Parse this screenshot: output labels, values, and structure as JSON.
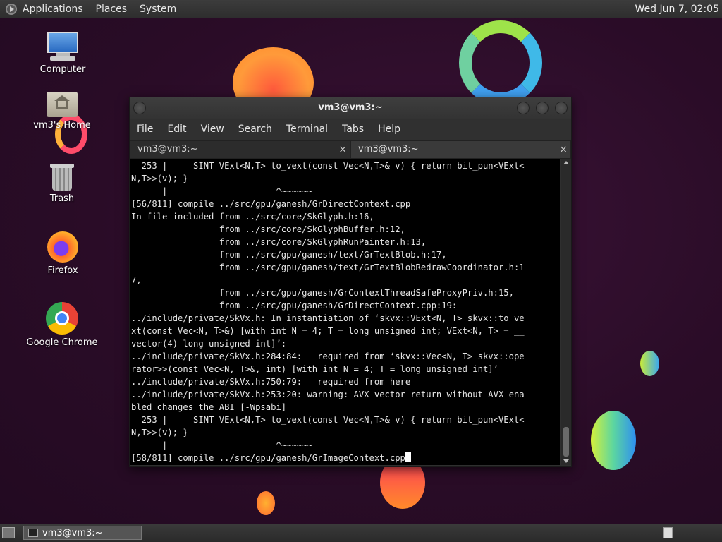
{
  "top_panel": {
    "menus": [
      "Applications",
      "Places",
      "System"
    ],
    "clock": "Wed Jun  7, 02:05"
  },
  "desktop_icons": [
    {
      "label": "Computer",
      "icon": "computer-icon"
    },
    {
      "label": "vm3's Home",
      "icon": "home-folder-icon"
    },
    {
      "label": "Trash",
      "icon": "trash-icon"
    },
    {
      "label": "Firefox",
      "icon": "firefox-icon"
    },
    {
      "label": "Google Chrome",
      "icon": "chrome-icon"
    }
  ],
  "terminal": {
    "title": "vm3@vm3:~",
    "menus": [
      "File",
      "Edit",
      "View",
      "Search",
      "Terminal",
      "Tabs",
      "Help"
    ],
    "tabs": [
      {
        "label": "vm3@vm3:~",
        "close": "×"
      },
      {
        "label": "vm3@vm3:~",
        "close": "×"
      }
    ],
    "lines": [
      "  253 |     SINT VExt<N,T> to_vext(const Vec<N,T>& v) { return bit_pun<VExt<",
      "N,T>>(v); }",
      "      |                     ^~~~~~~",
      "[56/811] compile ../src/gpu/ganesh/GrDirectContext.cpp",
      "In file included from ../src/core/SkGlyph.h:16,",
      "                 from ../src/core/SkGlyphBuffer.h:12,",
      "                 from ../src/core/SkGlyphRunPainter.h:13,",
      "                 from ../src/gpu/ganesh/text/GrTextBlob.h:17,",
      "                 from ../src/gpu/ganesh/text/GrTextBlobRedrawCoordinator.h:1",
      "7,",
      "                 from ../src/gpu/ganesh/GrContextThreadSafeProxyPriv.h:15,",
      "                 from ../src/gpu/ganesh/GrDirectContext.cpp:19:",
      "../include/private/SkVx.h: In instantiation of ‘skvx::VExt<N, T> skvx::to_ve",
      "xt(const Vec<N, T>&) [with int N = 4; T = long unsigned int; VExt<N, T> = __",
      "vector(4) long unsigned int]’:",
      "../include/private/SkVx.h:284:84:   required from ‘skvx::Vec<N, T> skvx::ope",
      "rator>>(const Vec<N, T>&, int) [with int N = 4; T = long unsigned int]’",
      "../include/private/SkVx.h:750:79:   required from here",
      "../include/private/SkVx.h:253:20: warning: AVX vector return without AVX ena",
      "bled changes the ABI [-Wpsabi]",
      "  253 |     SINT VExt<N,T> to_vext(const Vec<N,T>& v) { return bit_pun<VExt<",
      "N,T>>(v); }",
      "      |                     ^~~~~~~"
    ],
    "prompt_line": "[58/811] compile ../src/gpu/ganesh/GrImageContext.cpp"
  },
  "bottom_panel": {
    "task_label": "vm3@vm3:~"
  }
}
